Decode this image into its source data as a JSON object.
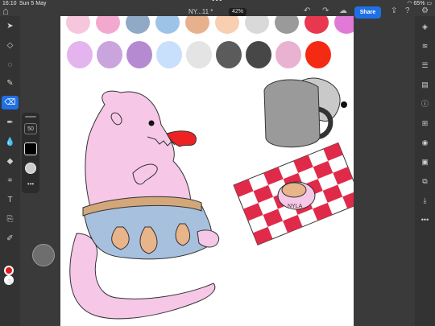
{
  "status": {
    "time": "16:10",
    "date": "Sun 5 May",
    "battery": "65%"
  },
  "header": {
    "doc_title": "NY...11 *",
    "zoom": "42%",
    "share_label": "Share"
  },
  "brush": {
    "size": "50"
  },
  "drawing": {
    "bowl_label": "NYLA"
  },
  "palette": {
    "row1": [
      "#f6c7dc",
      "#f3a9cf",
      "#8fa9c6",
      "#9dc3e6",
      "#e8b18d",
      "#f8cfb0",
      "#d9d9d9",
      "#9a9a9a",
      "#e8384f",
      "#e07ad6"
    ],
    "row2": [
      "#e3b4ee",
      "#c9a4dd",
      "#b58ad1",
      "#c8e0fb",
      "#e4e4e4",
      "#5b5b5b",
      "#474747",
      "#e8b2d0",
      "#f52a12"
    ]
  },
  "colors": {
    "accent": "#1f70e6",
    "fg_color": "#e01a1a",
    "bg_color": "#ffffff"
  },
  "icons": {
    "left": [
      "move-icon",
      "transform-icon",
      "lasso-icon",
      "brush-icon",
      "eraser-icon",
      "smudge-icon",
      "blur-icon",
      "fill-icon",
      "crop-icon",
      "text-icon",
      "clone-icon",
      "eyedropper-icon"
    ],
    "right": [
      "layers-icon",
      "layer-stack-icon",
      "adjustments-icon",
      "comments-icon",
      "info-icon",
      "add-layer-icon",
      "visibility-icon",
      "mask-icon",
      "flip-icon",
      "import-icon",
      "more-icon"
    ]
  }
}
